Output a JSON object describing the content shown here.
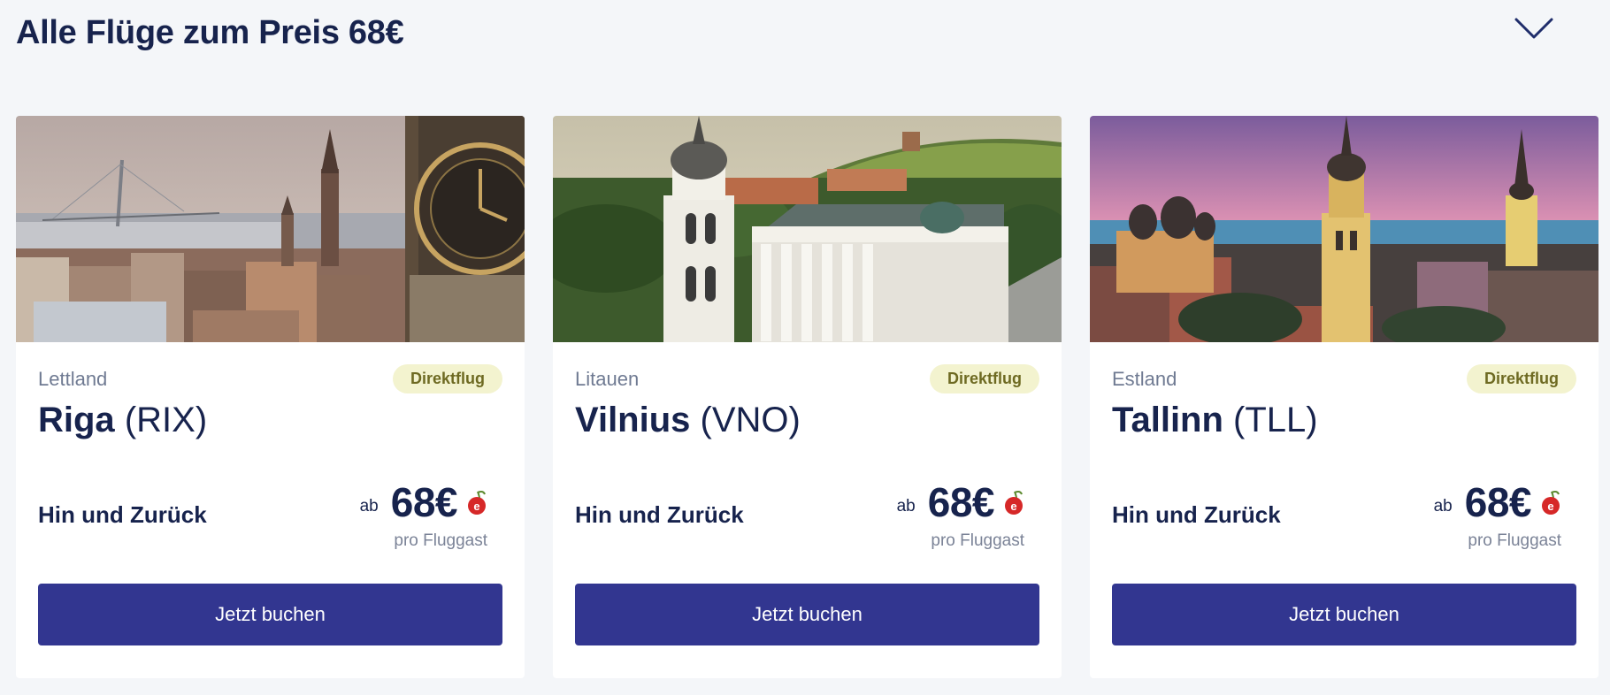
{
  "page": {
    "title": "Alle Flüge zum Preis 68€"
  },
  "icons": {
    "toggle": "chevron-down-icon",
    "currency": "cherry-euro-icon"
  },
  "colors": {
    "background": "#f4f6f9",
    "heading": "#17234d",
    "button": "#323690",
    "badge_bg": "#f3f3cf",
    "badge_text": "#6e6a22",
    "cherry": "#d62828"
  },
  "cards": [
    {
      "country": "Lettland",
      "badge": "Direktflug",
      "city": "Riga",
      "airport": "(RIX)",
      "trip_type": "Hin und Zurück",
      "price_prefix": "ab",
      "price": "68€",
      "price_note": "pro Fluggast",
      "button": "Jetzt buchen",
      "image": "riga-cityscape"
    },
    {
      "country": "Litauen",
      "badge": "Direktflug",
      "city": "Vilnius",
      "airport": "(VNO)",
      "trip_type": "Hin und Zurück",
      "price_prefix": "ab",
      "price": "68€",
      "price_note": "pro Fluggast",
      "button": "Jetzt buchen",
      "image": "vilnius-cathedral"
    },
    {
      "country": "Estland",
      "badge": "Direktflug",
      "city": "Tallinn",
      "airport": "(TLL)",
      "trip_type": "Hin und Zurück",
      "price_prefix": "ab",
      "price": "68€",
      "price_note": "pro Fluggast",
      "button": "Jetzt buchen",
      "image": "tallinn-old-town"
    }
  ]
}
